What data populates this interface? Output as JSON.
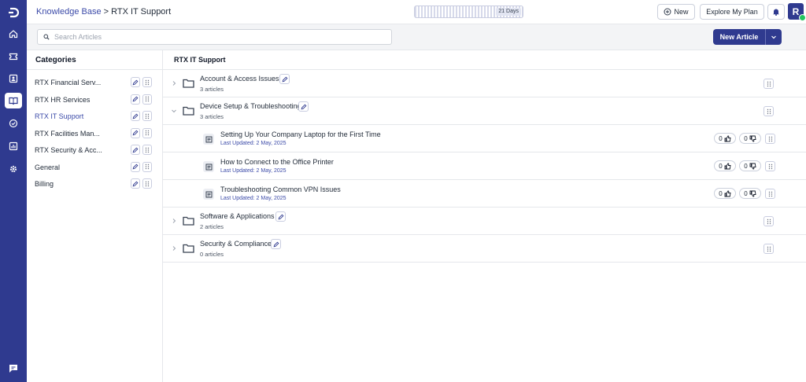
{
  "breadcrumb": {
    "root": "Knowledge Base",
    "separator": ">",
    "current": "RTX IT Support"
  },
  "trial": {
    "days_label": "21 Days"
  },
  "header": {
    "new_label": "New",
    "plan_label": "Explore My Plan",
    "avatar_letter": "R"
  },
  "search": {
    "placeholder": "Search Articles"
  },
  "new_article_label": "New Article",
  "categories": {
    "title": "Categories",
    "items": [
      {
        "label": "RTX Financial Serv..."
      },
      {
        "label": "RTX HR Services"
      },
      {
        "label": "RTX IT Support"
      },
      {
        "label": "RTX Facilities Man..."
      },
      {
        "label": "RTX Security & Acc..."
      },
      {
        "label": "General"
      },
      {
        "label": "Billing"
      }
    ],
    "active_index": 2
  },
  "main": {
    "title": "RTX IT Support",
    "folders": [
      {
        "name": "Account & Access Issues",
        "count": "3 articles",
        "expanded": false
      },
      {
        "name": "Device Setup & Troubleshooting",
        "count": "3 articles",
        "expanded": true,
        "articles": [
          {
            "title": "Setting Up Your Company Laptop for the First Time",
            "updated": "Last Updated: 2 May, 2025",
            "likes": "0",
            "dislikes": "0"
          },
          {
            "title": "How to Connect to the Office Printer",
            "updated": "Last Updated: 2 May, 2025",
            "likes": "0",
            "dislikes": "0"
          },
          {
            "title": "Troubleshooting Common VPN Issues",
            "updated": "Last Updated: 2 May, 2025",
            "likes": "0",
            "dislikes": "0"
          }
        ]
      },
      {
        "name": "Software & Applications",
        "count": "2 articles",
        "expanded": false
      },
      {
        "name": "Security & Compliance",
        "count": "0 articles",
        "expanded": false
      }
    ]
  },
  "colors": {
    "brand": "#2f3a8f",
    "link": "#3b4aa8",
    "success": "#22c55e"
  },
  "icons": {
    "rail": [
      "home-icon",
      "ticket-icon",
      "contacts-icon",
      "knowledge-base-icon",
      "check-circle-icon",
      "reports-icon",
      "settings-icon"
    ],
    "rail_active_index": 3
  }
}
